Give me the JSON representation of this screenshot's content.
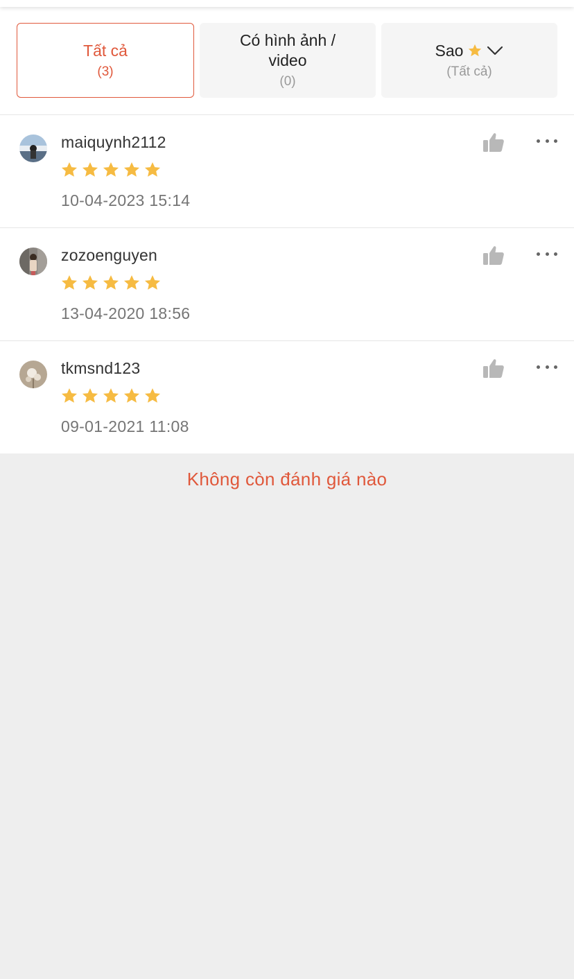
{
  "filters": [
    {
      "label": "Tất cả",
      "count": "(3)",
      "selected": true
    },
    {
      "label": "Có hình ảnh / video",
      "count": "(0)",
      "selected": false
    },
    {
      "label": "Sao",
      "count": "(Tất cả)",
      "selected": false,
      "icons": [
        "star-icon",
        "chevron-down-icon"
      ]
    }
  ],
  "reviews": [
    {
      "username": "maiquynh2112",
      "rating": 5,
      "date": "10-04-2023 15:14"
    },
    {
      "username": "zozoenguyen",
      "rating": 5,
      "date": "13-04-2020 18:56"
    },
    {
      "username": "tkmsnd123",
      "rating": 5,
      "date": "09-01-2021 11:08"
    }
  ],
  "footer": {
    "end_text": "Không còn đánh giá nào"
  },
  "colors": {
    "accent": "#e0583b",
    "star": "#f6bb42",
    "icon_gray": "#b8b8b8",
    "background": "#eeeeee"
  }
}
